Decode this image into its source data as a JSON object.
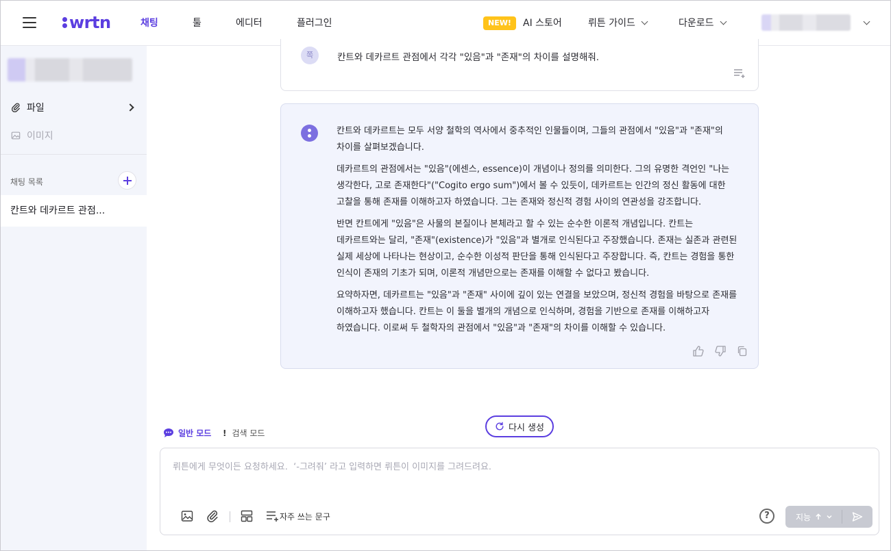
{
  "topbar": {
    "logo": "wrtn",
    "nav": [
      "채팅",
      "툴",
      "에디터",
      "플러그인"
    ],
    "new_badge": "NEW!",
    "ai_store": "AI 스토어",
    "guide": "뤼튼 가이드",
    "download": "다운로드"
  },
  "sidebar": {
    "file_label": "파일",
    "image_label": "이미지",
    "chat_list_label": "채팅 목록",
    "chat_items": [
      "칸트와 데카르트 관점..."
    ]
  },
  "conversation": {
    "user_avatar": "쪽",
    "user_message": "칸트와 데카르트 관점에서 각각 \"있음\"과 \"존재\"의 차이를 설명해줘.",
    "ai_paragraphs": [
      "칸트와 데카르트는 모두 서양 철학의 역사에서 중추적인 인물들이며, 그들의 관점에서 \"있음\"과 \"존재\"의 차이를 살펴보겠습니다.",
      "데카르트의 관점에서는 \"있음\"(에센스, essence)이 개념이나 정의를 의미한다. 그의 유명한 격언인 \"나는 생각한다, 고로 존재한다\"(\"Cogito ergo sum\")에서 볼 수 있듯이, 데카르트는 인간의 정신 활동에 대한 고찰을 통해 존재를 이해하고자 하였습니다. 그는 존재와 정신적 경험 사이의 연관성을 강조합니다.",
      "반면 칸트에게 \"있음\"은 사물의 본질이나 본체라고 할 수 있는 순수한 이론적 개념입니다. 칸트는 데카르트와는 달리, \"존재\"(existence)가 \"있음\"과 별개로 인식된다고 주장했습니다. 존재는 실존과 관련된 실제 세상에 나타나는 현상이고, 순수한 이성적 판단을 통해 인식된다고 주장합니다. 즉, 칸트는 경험을 통한 인식이 존재의 기초가 되며, 이론적 개념만으로는 존재를 이해할 수 없다고 봤습니다.",
      "요약하자면, 데카르트는 \"있음\"과 \"존재\" 사이에 깊이 있는 연결을 보았으며, 정신적 경험을 바탕으로 존재를 이해하고자 했습니다. 칸트는 이 둘을 별개의 개념으로 인식하며, 경험을 기반으로 존재를 이해하고자 하였습니다. 이로써 두 철학자의 관점에서 \"있음\"과 \"존재\"의 차이를 이해할 수 있습니다."
    ],
    "regenerate_label": "다시 생성"
  },
  "modes": {
    "normal": "일반 모드",
    "search": "검색 모드"
  },
  "composer": {
    "placeholder": "뤼튼에게 무엇이든 요청하세요.  ‘-그려줘’ 라고 입력하면 뤼튼이 이미지를 그려드려요.",
    "frequent_phrases": "자주 쓰는 문구",
    "help": "?",
    "model": "지능"
  },
  "colors": {
    "accent": "#5b3ee0",
    "badge": "#ffc31a",
    "ai_card_bg": "#f2f4fd",
    "sidebar_bg": "#f3f5fb"
  }
}
